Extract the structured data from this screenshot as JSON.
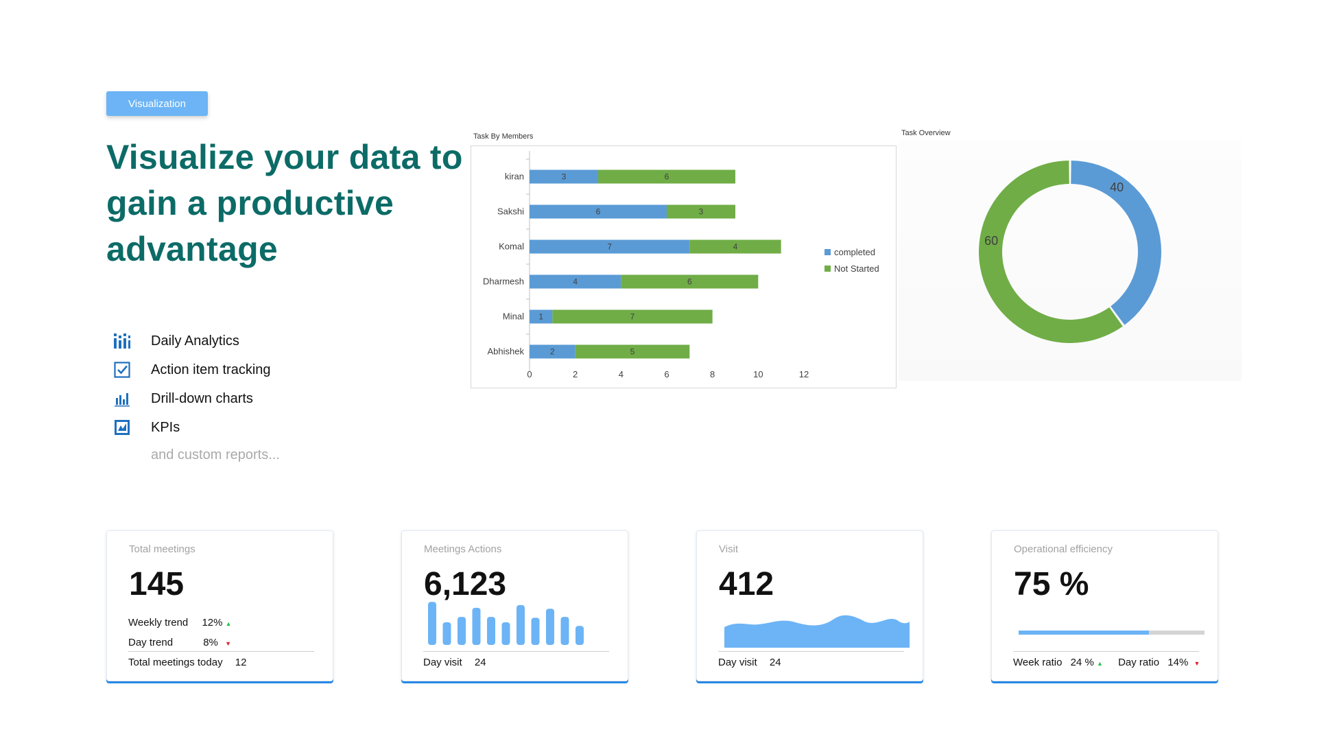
{
  "badge": "Visualization",
  "headline": "Visualize your data to gain a productive advantage",
  "features": [
    {
      "icon": "bar-grid-icon",
      "label": "Daily Analytics"
    },
    {
      "icon": "checkbox-icon",
      "label": "Action item tracking"
    },
    {
      "icon": "bar-chart-icon",
      "label": "Drill-down charts"
    },
    {
      "icon": "kpi-chart-icon",
      "label": "KPIs"
    }
  ],
  "more_text": "and custom reports...",
  "colors": {
    "blue": "#5b9bd5",
    "green": "#70ad47",
    "accent": "#6cb4f5",
    "teal": "#0c6b67"
  },
  "chart_data": [
    {
      "type": "bar",
      "orientation": "horizontal",
      "stacked": true,
      "title": "Task By Members",
      "categories": [
        "kiran",
        "Sakshi",
        "Komal",
        "Dharmesh",
        "Minal",
        "Abhishek"
      ],
      "series": [
        {
          "name": "completed",
          "values": [
            3,
            6,
            7,
            4,
            1,
            2
          ]
        },
        {
          "name": "Not Started",
          "values": [
            6,
            3,
            4,
            6,
            7,
            5
          ]
        }
      ],
      "xlim": [
        0,
        12
      ],
      "xticks": [
        0,
        2,
        4,
        6,
        8,
        10,
        12
      ],
      "legend": "right"
    },
    {
      "type": "pie",
      "donut": true,
      "title": "Task Overview",
      "labels": [
        "40",
        "60"
      ],
      "values": [
        40,
        60
      ],
      "colors": [
        "#5b9bd5",
        "#70ad47"
      ]
    }
  ],
  "cards": [
    {
      "title": "Total meetings",
      "value": "145",
      "weekly_label": "Weekly trend",
      "weekly_value": "12%",
      "day_label": "Day trend",
      "day_value": "8%",
      "foot_label": "Total meetings today",
      "foot_value": "12"
    },
    {
      "title": "Meetings Actions",
      "value": "6,123",
      "spark_bars": [
        0.95,
        0.5,
        0.62,
        0.82,
        0.62,
        0.5,
        0.88,
        0.6,
        0.8,
        0.62,
        0.42
      ],
      "foot_label": "Day visit",
      "foot_value": "24"
    },
    {
      "title": "Visit",
      "value": "412",
      "foot_label": "Day visit",
      "foot_value": "24"
    },
    {
      "title": "Operational efficiency",
      "value": "75 %",
      "progress": 0.7,
      "week_label": "Week ratio",
      "week_value": "24 %",
      "day_label": "Day ratio",
      "day_value": "14%"
    }
  ]
}
